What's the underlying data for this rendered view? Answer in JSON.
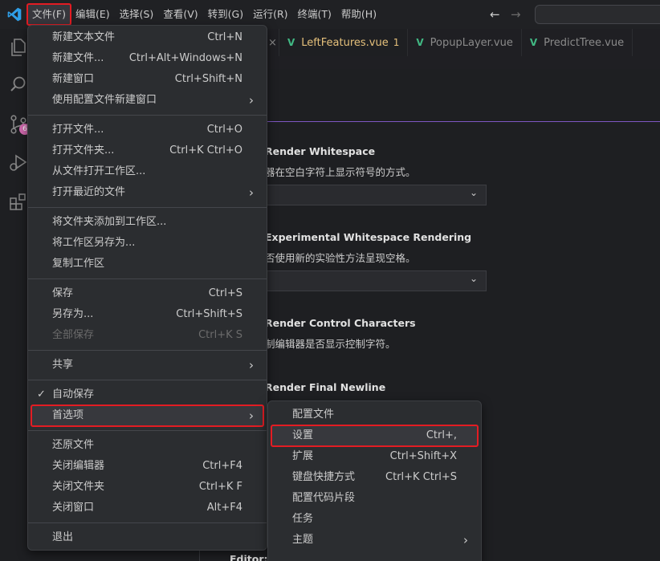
{
  "menubar": {
    "items": [
      "文件(F)",
      "编辑(E)",
      "选择(S)",
      "查看(V)",
      "转到(G)",
      "运行(R)",
      "终端(T)",
      "帮助(H)"
    ],
    "active": "文件(F)"
  },
  "tabs": [
    {
      "label": "LeftFeatures.vue",
      "badge": "1",
      "icon": "V",
      "active": true
    },
    {
      "label": "PopupLayer.vue",
      "icon": "V",
      "active": false
    },
    {
      "label": "PredictTree.vue",
      "icon": "V",
      "active": false
    }
  ],
  "activity_badge": "6",
  "settings": [
    {
      "title": "Render Whitespace",
      "desc": "器在空白字符上显示符号的方式。",
      "has_dropdown": true
    },
    {
      "title": "Experimental Whitespace Rendering",
      "desc": "否使用新的实验性方法呈现空格。",
      "has_dropdown": true
    },
    {
      "title": "Render Control Characters",
      "desc": "制编辑器是否显示控制字符。",
      "has_dropdown": false
    },
    {
      "title": "Render Final Newline",
      "desc": "",
      "has_dropdown": false
    }
  ],
  "editor_footer": "Editor: F",
  "file_menu": {
    "groups": [
      [
        {
          "label": "新建文本文件",
          "shortcut": "Ctrl+N"
        },
        {
          "label": "新建文件...",
          "shortcut": "Ctrl+Alt+Windows+N"
        },
        {
          "label": "新建窗口",
          "shortcut": "Ctrl+Shift+N"
        },
        {
          "label": "使用配置文件新建窗口",
          "submenu": true
        }
      ],
      [
        {
          "label": "打开文件...",
          "shortcut": "Ctrl+O"
        },
        {
          "label": "打开文件夹...",
          "shortcut": "Ctrl+K Ctrl+O"
        },
        {
          "label": "从文件打开工作区..."
        },
        {
          "label": "打开最近的文件",
          "submenu": true
        }
      ],
      [
        {
          "label": "将文件夹添加到工作区..."
        },
        {
          "label": "将工作区另存为..."
        },
        {
          "label": "复制工作区"
        }
      ],
      [
        {
          "label": "保存",
          "shortcut": "Ctrl+S"
        },
        {
          "label": "另存为...",
          "shortcut": "Ctrl+Shift+S"
        },
        {
          "label": "全部保存",
          "shortcut": "Ctrl+K S",
          "disabled": true
        }
      ],
      [
        {
          "label": "共享",
          "submenu": true
        }
      ],
      [
        {
          "label": "自动保存",
          "checked": true
        },
        {
          "label": "首选项",
          "submenu": true,
          "highlight": true
        }
      ],
      [
        {
          "label": "还原文件"
        },
        {
          "label": "关闭编辑器",
          "shortcut": "Ctrl+F4"
        },
        {
          "label": "关闭文件夹",
          "shortcut": "Ctrl+K F"
        },
        {
          "label": "关闭窗口",
          "shortcut": "Alt+F4"
        }
      ],
      [
        {
          "label": "退出"
        }
      ]
    ]
  },
  "preferences_submenu": {
    "items": [
      {
        "label": "配置文件"
      },
      {
        "label": "设置",
        "shortcut": "Ctrl+,",
        "highlight": true
      },
      {
        "label": "扩展",
        "shortcut": "Ctrl+Shift+X"
      },
      {
        "label": "键盘快捷方式",
        "shortcut": "Ctrl+K Ctrl+S"
      },
      {
        "label": "配置代码片段"
      },
      {
        "label": "任务"
      },
      {
        "label": "主题",
        "submenu": true
      }
    ]
  },
  "colors": {
    "accent_red": "#e31c23",
    "vue_green": "#41b883",
    "modified_yellow": "#e5c07b",
    "badge_pink": "#d36ab0"
  }
}
